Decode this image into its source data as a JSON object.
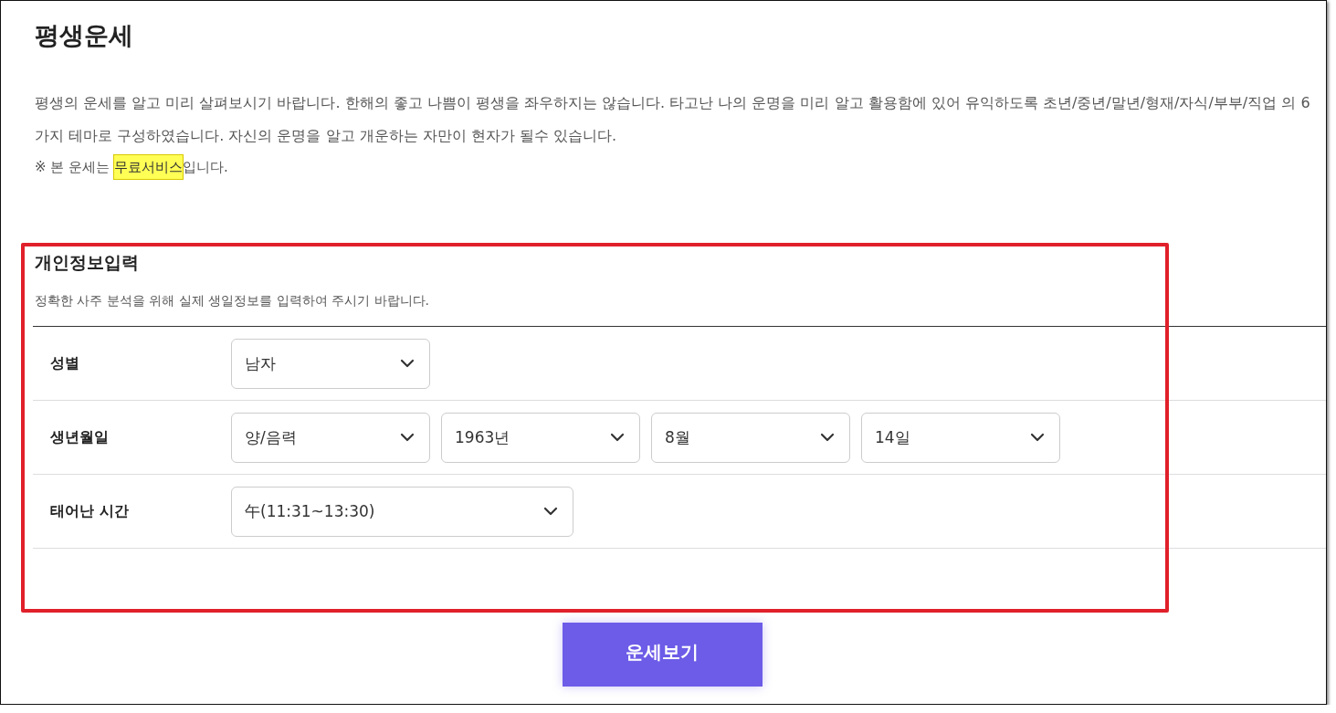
{
  "title": "평생운세",
  "description": "평생의 운세를 알고 미리 살펴보시기 바랍니다. 한해의 좋고 나쁨이 평생을 좌우하지는 않습니다. 타고난 나의 운명을 미리 알고 활용함에 있어 유익하도록 초년/중년/말년/형재/자식/부부/직업 의 6가지 테마로 구성하였습니다. 자신의 운명을 알고 개운하는 자만이 현자가 될수 있습니다.",
  "notice": {
    "before": "※ 본 운세는 ",
    "highlight": "무료서비스",
    "after": "입니다."
  },
  "form": {
    "title": "개인정보입력",
    "subtitle": "정확한 사주 분석을 위해 실제 생일정보를 입력하여 주시기 바랍니다.",
    "annotated": true,
    "rows": [
      {
        "label": "성별",
        "selects": [
          {
            "value": "남자",
            "kind": "normal"
          }
        ]
      },
      {
        "label": "생년월일",
        "selects": [
          {
            "value": "양/음력",
            "kind": "normal"
          },
          {
            "value": "1963년",
            "kind": "normal"
          },
          {
            "value": "8월",
            "kind": "normal"
          },
          {
            "value": "14일",
            "kind": "normal"
          }
        ]
      },
      {
        "label": "태어난 시간",
        "selects": [
          {
            "value": "午(11:31~13:30)",
            "kind": "wide"
          }
        ]
      }
    ]
  },
  "submit_button": "운세보기"
}
